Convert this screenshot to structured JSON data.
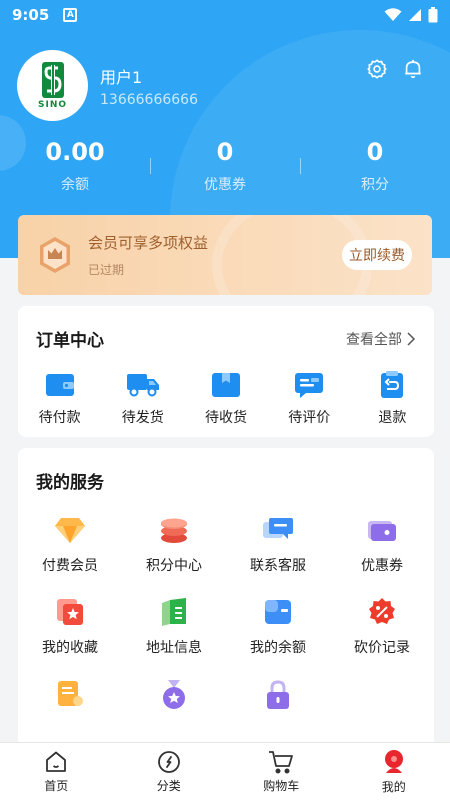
{
  "status_bar": {
    "time": "9:05",
    "notification_letter": "A"
  },
  "profile": {
    "username": "用户1",
    "phone": "13666666666",
    "logo_text": "SINO"
  },
  "stats": [
    {
      "value": "0.00",
      "label": "余额"
    },
    {
      "value": "0",
      "label": "优惠券"
    },
    {
      "value": "0",
      "label": "积分"
    }
  ],
  "vip": {
    "title": "会员可享多项权益",
    "subtitle": "已过期",
    "button": "立即续费"
  },
  "orders": {
    "title": "订单中心",
    "view_all": "查看全部",
    "items": [
      {
        "label": "待付款",
        "icon": "wallet-icon"
      },
      {
        "label": "待发货",
        "icon": "truck-icon"
      },
      {
        "label": "待收货",
        "icon": "box-icon"
      },
      {
        "label": "待评价",
        "icon": "review-icon"
      },
      {
        "label": "退款",
        "icon": "refund-icon"
      }
    ]
  },
  "services": {
    "title": "我的服务",
    "items": [
      {
        "label": "付费会员",
        "icon": "diamond-icon"
      },
      {
        "label": "积分中心",
        "icon": "coins-icon"
      },
      {
        "label": "联系客服",
        "icon": "chat-icon"
      },
      {
        "label": "优惠券",
        "icon": "coupon-icon"
      },
      {
        "label": "我的收藏",
        "icon": "favorite-icon"
      },
      {
        "label": "地址信息",
        "icon": "address-icon"
      },
      {
        "label": "我的余额",
        "icon": "balance-icon"
      },
      {
        "label": "砍价记录",
        "icon": "bargain-icon"
      },
      {
        "label": "",
        "icon": "document-icon"
      },
      {
        "label": "",
        "icon": "medal-icon"
      },
      {
        "label": "",
        "icon": "lock-icon"
      }
    ]
  },
  "tabbar": [
    {
      "label": "首页",
      "icon": "home-icon"
    },
    {
      "label": "分类",
      "icon": "category-icon"
    },
    {
      "label": "购物车",
      "icon": "cart-icon"
    },
    {
      "label": "我的",
      "icon": "profile-icon",
      "active": true
    }
  ],
  "colors": {
    "primary": "#2ea6f5",
    "vip_gold": "#a0602e",
    "active_tab": "#e8262d"
  }
}
